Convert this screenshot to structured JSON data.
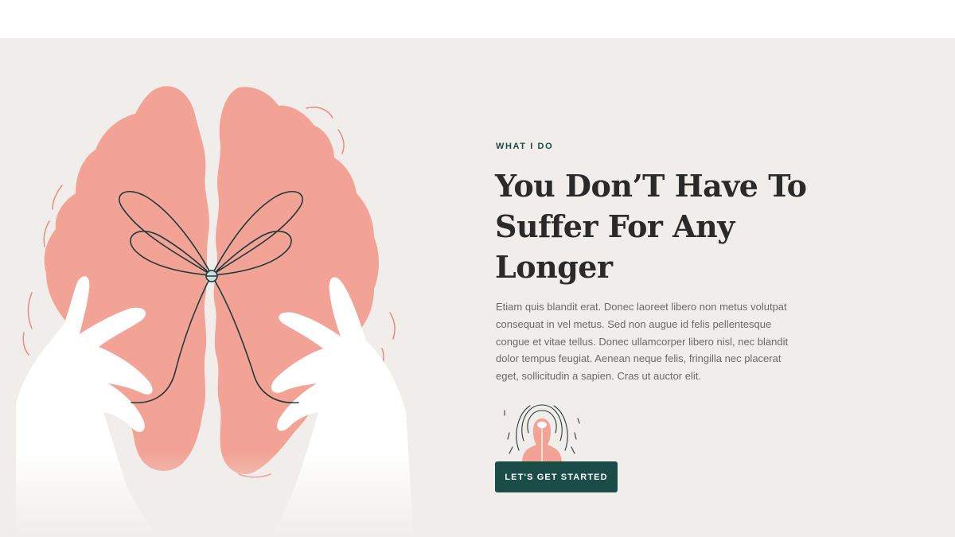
{
  "hero": {
    "eyebrow": "WHAT I DO",
    "heading": "You Don’T Have To Suffer For Any Longer",
    "body": "Etiam quis blandit erat. Donec laoreet libero non metus volutpat consequat in vel metus. Sed non augue id felis pellentesque congue et vitae tellus. Donec ullamcorper libero nisl, nec blandit dolor tempus feugiat. Aenean neque felis, fringilla nec placerat eget, sollicitudin a sapien. Cras ut auctor elit.",
    "cta_label": "LET'S GET STARTED"
  },
  "colors": {
    "background": "#f0edea",
    "brain": "#f2a395",
    "accent": "#1a4c48",
    "heading": "#2a2a2a",
    "body": "#6a6a6a"
  },
  "icons": {
    "illustration": "brain-hands-tied-string-illustration",
    "figure": "person-head-waves-icon"
  }
}
